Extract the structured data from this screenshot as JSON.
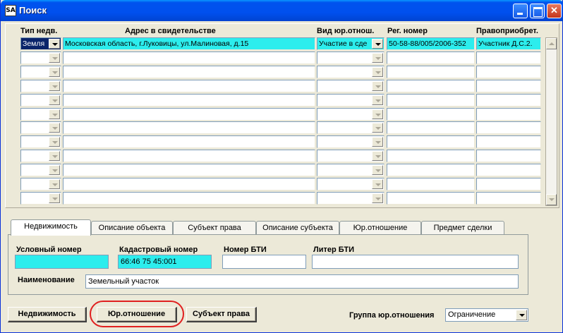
{
  "window": {
    "title": "Поиск",
    "icon_text": "SA",
    "controls": {
      "minimize": "minimize-icon",
      "maximize": "maximize-icon",
      "close": "close-icon"
    }
  },
  "grid": {
    "columns": [
      "Тип недв.",
      "Адрес в свидетельстве",
      "Вид юр.отнош.",
      "Рег. номер",
      "Правоприобрет."
    ],
    "rows": [
      [
        "Земля",
        "Московская область, г.Луковицы, ул.Малиновая, д.15",
        "Участие в сде",
        "50-58-88/005/2006-352",
        "Участник Д.С.2."
      ],
      [
        "",
        "",
        "",
        "",
        ""
      ],
      [
        "",
        "",
        "",
        "",
        ""
      ],
      [
        "",
        "",
        "",
        "",
        ""
      ],
      [
        "",
        "",
        "",
        "",
        ""
      ],
      [
        "",
        "",
        "",
        "",
        ""
      ],
      [
        "",
        "",
        "",
        "",
        ""
      ],
      [
        "",
        "",
        "",
        "",
        ""
      ],
      [
        "",
        "",
        "",
        "",
        ""
      ],
      [
        "",
        "",
        "",
        "",
        ""
      ],
      [
        "",
        "",
        "",
        "",
        ""
      ],
      [
        "",
        "",
        "",
        "",
        ""
      ]
    ]
  },
  "tabs": [
    "Недвижимость",
    "Описание объекта",
    "Субъект права",
    "Описание субъекта",
    "Юр.отношение",
    "Предмет сделки"
  ],
  "active_tab": "Недвижимость",
  "form": {
    "conditional_number_label": "Условный номер",
    "conditional_number_value": "",
    "cadastral_number_label": "Кадастровый номер",
    "cadastral_number_value": "66:46 75 45:001",
    "bti_number_label": "Номер БТИ",
    "bti_number_value": "",
    "bti_liter_label": "Литер БТИ",
    "bti_liter_value": "",
    "name_label": "Наименование",
    "name_value": "Земельный участок"
  },
  "buttons": {
    "realty": "Недвижимость",
    "legal_relation": "Юр.отношение",
    "subject": "Субъект права"
  },
  "group": {
    "label": "Группа юр.отношения",
    "value": "Ограничение"
  },
  "colors": {
    "highlight": "#2CEDED",
    "titlebar": "#0053EE",
    "annotation": "#E02020"
  }
}
